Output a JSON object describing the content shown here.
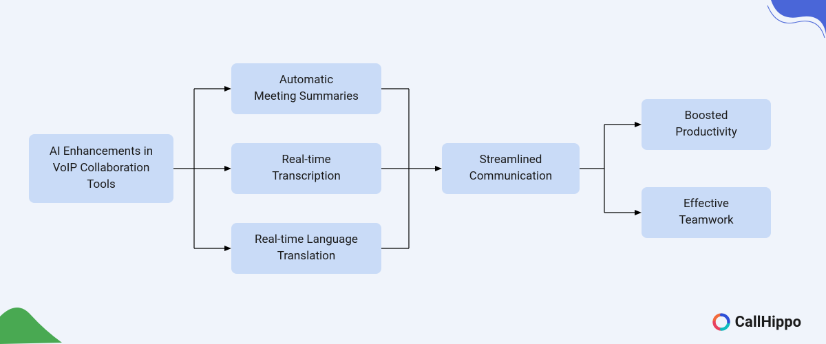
{
  "diagram": {
    "root": {
      "label": "AI Enhancements in VoIP Collaboration Tools"
    },
    "features": [
      {
        "label": "Automatic\nMeeting Summaries"
      },
      {
        "label": "Real-time\nTranscription"
      },
      {
        "label": "Real-time Language\nTranslation"
      }
    ],
    "outcome": {
      "label": "Streamlined\nCommunication"
    },
    "benefits": [
      {
        "label": "Boosted\nProductivity"
      },
      {
        "label": "Effective\nTeamwork"
      }
    ]
  },
  "brand": {
    "name": "CallHippo"
  },
  "colors": {
    "node_bg": "#c9dbf7",
    "page_bg": "#f0f4fb",
    "connector": "#000000",
    "brand_green": "#49a952",
    "brand_blue": "#4a66d8"
  }
}
